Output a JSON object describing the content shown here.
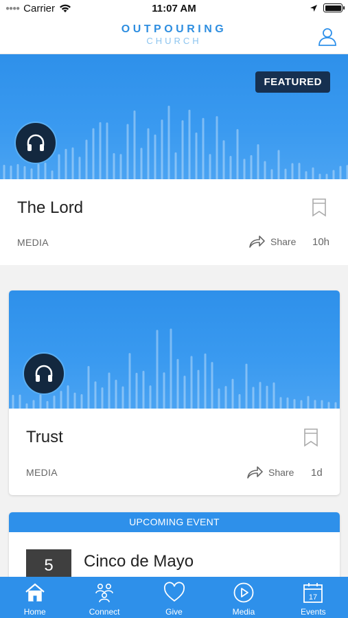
{
  "status_bar": {
    "carrier": "Carrier",
    "time": "11:07 AM"
  },
  "header": {
    "logo_main": "OUTPOURING",
    "logo_sub": "CHURCH",
    "profile_icon": "user-icon"
  },
  "featured": {
    "badge": "FEATURED",
    "title": "The Lord",
    "category": "MEDIA",
    "share_label": "Share",
    "age": "10h",
    "icon": "headphones-icon"
  },
  "media_item": {
    "title": "Trust",
    "category": "MEDIA",
    "share_label": "Share",
    "age": "1d",
    "icon": "headphones-icon"
  },
  "event": {
    "header": "UPCOMING EVENT",
    "date_day": "5",
    "title": "Cinco de Mayo"
  },
  "tabs": [
    {
      "label": "Home",
      "icon": "home-icon"
    },
    {
      "label": "Connect",
      "icon": "connect-icon"
    },
    {
      "label": "Give",
      "icon": "heart-icon"
    },
    {
      "label": "Media",
      "icon": "play-icon"
    },
    {
      "label": "Events",
      "icon": "calendar-icon"
    }
  ],
  "colors": {
    "accent": "#2E90EA",
    "badge_dark": "#163050",
    "date_box": "#3F3F3F"
  }
}
